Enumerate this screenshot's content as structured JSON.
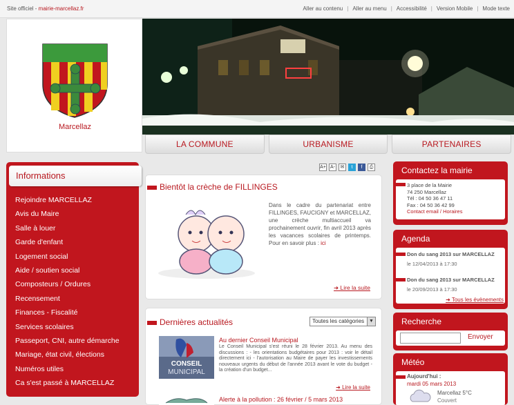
{
  "topbar": {
    "prefix": "Site officiel - ",
    "site": "mairie-marcellaz.fr",
    "links": [
      "Aller au contenu",
      "Aller au menu",
      "Accessibilité",
      "Version Mobile",
      "Mode texte"
    ]
  },
  "logo": {
    "town": "Marcellaz"
  },
  "nav": [
    "LA COMMUNE",
    "URBANISME",
    "PARTENAIRES"
  ],
  "sidebar": {
    "title": "Informations",
    "items": [
      "Rejoindre MARCELLAZ",
      "Avis du Maire",
      "Salle à louer",
      "Garde d'enfant",
      "Logement social",
      "Aide / soutien social",
      "Composteurs / Ordures",
      "Recensement",
      "Finances - Fiscalité",
      "Services scolaires",
      "Passeport, CNI, autre démarche",
      "Mariage, état civil, élections",
      "Numéros utiles",
      "Ca s'est passé à MARCELLAZ"
    ]
  },
  "tools": [
    "A+",
    "A-",
    "✉",
    "t",
    "f",
    "⎙"
  ],
  "creche": {
    "title": "Bientôt la crèche de FILLINGES",
    "text": "Dans le cadre du partenariat entre FILLINGES, FAUCIGNY et MARCELLAZ, une crèche multiaccueil va prochainement ouvrir, fin avril 2013 après les vacances scolaires de printemps. Pour en savoir plus : ",
    "link": "ici",
    "more": "Lire la suite"
  },
  "news": {
    "title": "Dernières actualités",
    "select": "Toutes les catégories",
    "item1_title": "Au dernier Conseil Municipal",
    "item1_text": "Le Conseil Municipal s'est réuni le 28 février 2013. Au menu des discussions : - les orientations budgétaires pour 2013 : voir le détail directement ici - l'autorisation au Maire de payer les investissements nouveaux urgents du début de l'année 2013 avant le vote du budget - la création d'un budget...",
    "item1_img": "CONSEIL MUNICIPAL",
    "more": "Lire la suite",
    "item2_title": "Alerte à la pollution : 26 février / 5 mars 2013"
  },
  "contact": {
    "title": "Contactez la mairie",
    "lines": [
      "3 place de la Mairie",
      "74 250 Marcellaz",
      "Tél : 04 50 36 47 11",
      "Fax : 04 50 36 42 99"
    ],
    "link": "Contact email / Horaires"
  },
  "agenda": {
    "title": "Agenda",
    "events": [
      {
        "title": "Don du sang 2013 sur MARCELLAZ",
        "date": "le 12/04/2013 à 17:30"
      },
      {
        "title": "Don du sang 2013 sur MARCELLAZ",
        "date": "le 20/09/2013 à 17:30"
      }
    ],
    "all": "Tous les évènements"
  },
  "search": {
    "title": "Recherche",
    "button": "Envoyer"
  },
  "meteo": {
    "title": "Météo",
    "today": "Aujourd'hui :",
    "date": "mardi 05 mars 2013",
    "place": "Marcellaz 5°C",
    "cond": "Couvert"
  }
}
